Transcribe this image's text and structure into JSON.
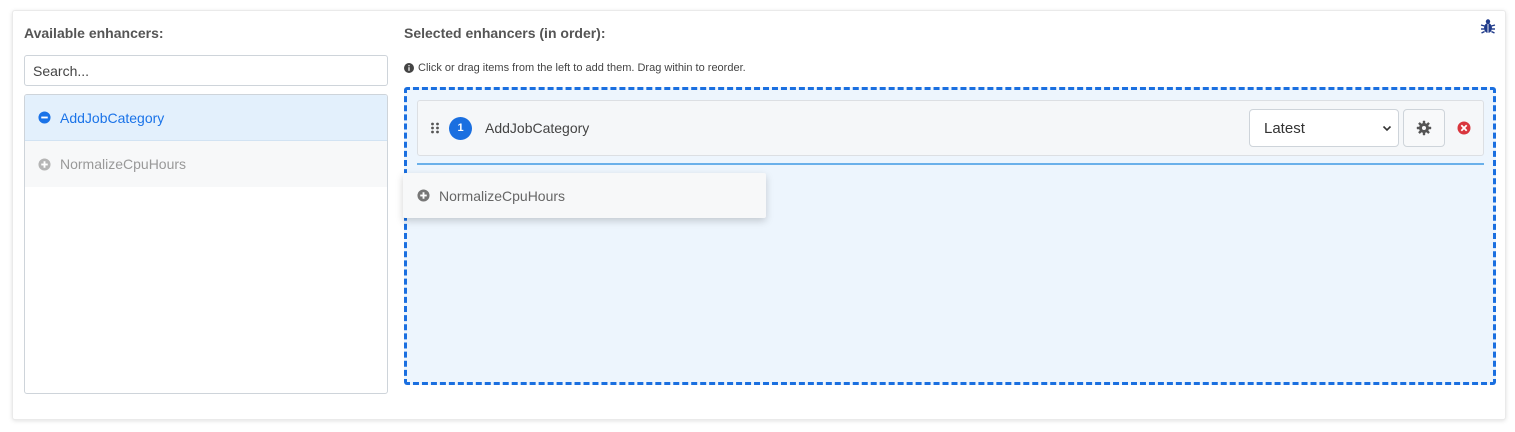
{
  "available": {
    "heading": "Available enhancers:",
    "search_placeholder": "Search...",
    "items": [
      {
        "label": "AddJobCategory",
        "state": "selected",
        "icon": "minus-circle-icon"
      },
      {
        "label": "NormalizeCpuHours",
        "state": "unselected",
        "icon": "plus-circle-icon"
      }
    ]
  },
  "selected": {
    "heading": "Selected enhancers (in order):",
    "hint": "Click or drag items from the left to add them. Drag within to reorder.",
    "items": [
      {
        "order": "1",
        "label": "AddJobCategory",
        "version": "Latest"
      }
    ]
  },
  "drag_ghost": {
    "label": "NormalizeCpuHours",
    "icon": "plus-circle-icon"
  },
  "colors": {
    "accent": "#1a6fe0",
    "selected_bg": "#e3f0fc",
    "dropzone_bg": "#edf5fd",
    "remove": "#d9363e"
  },
  "icons": {
    "debug": "bug-icon",
    "hint": "info-circle-icon",
    "drag": "drag-handle-icon",
    "settings": "gear-icon",
    "remove": "close-circle-icon",
    "dropdown": "chevron-down-icon"
  }
}
